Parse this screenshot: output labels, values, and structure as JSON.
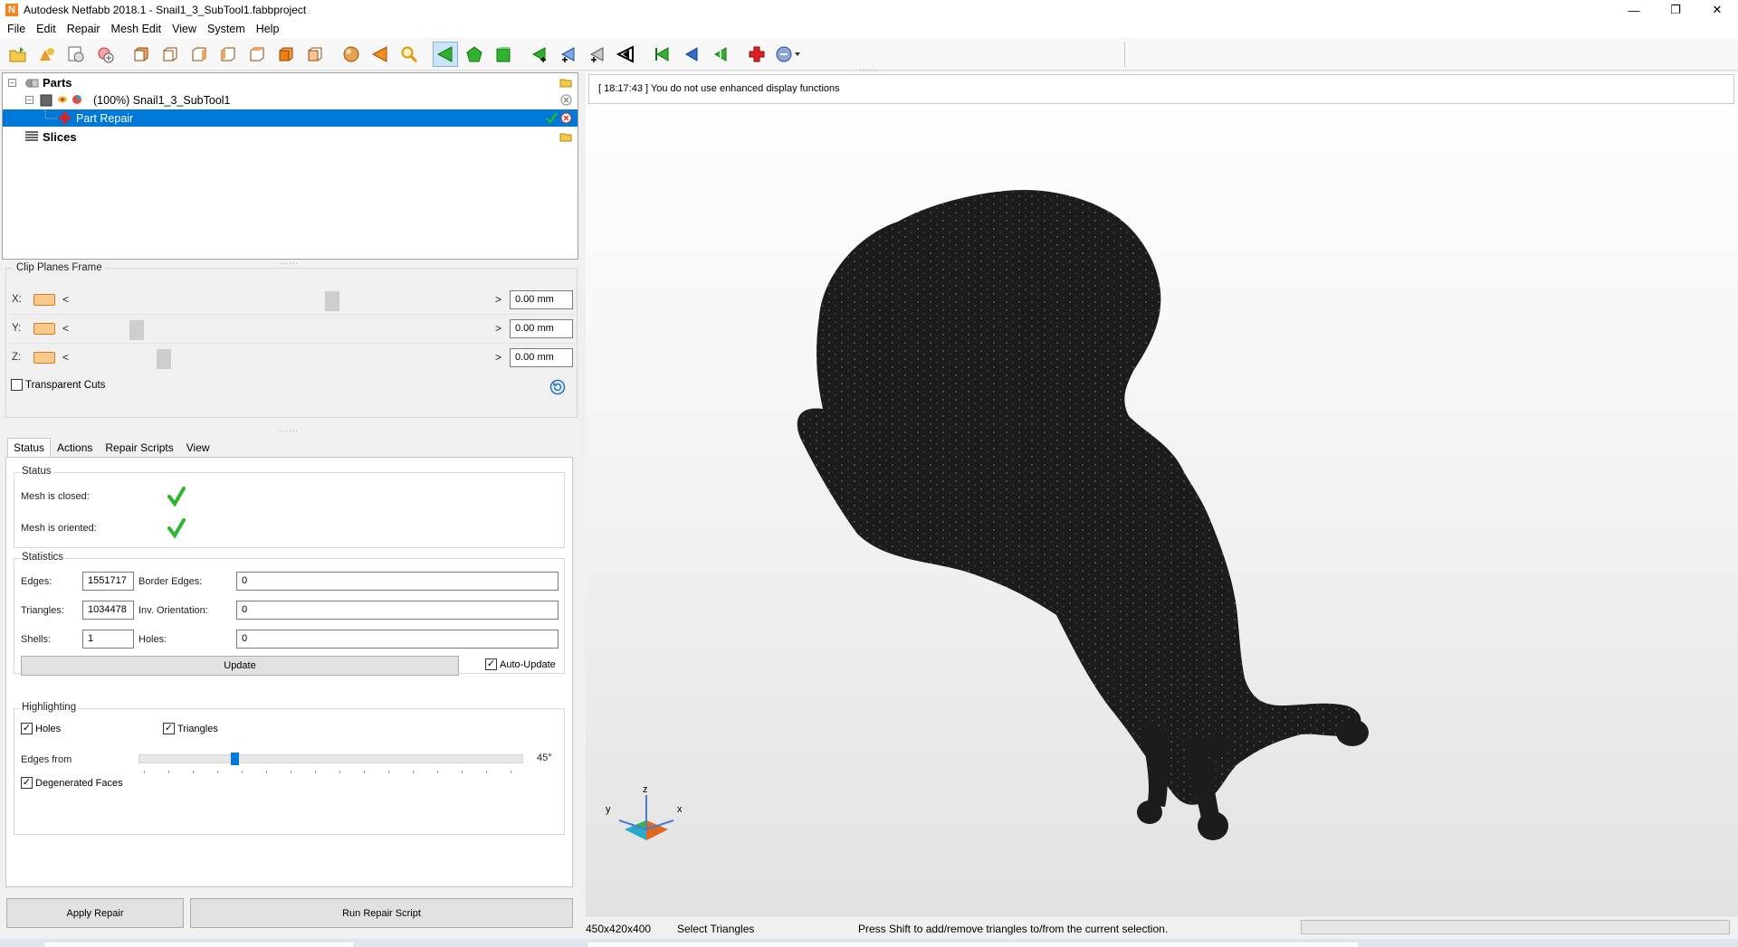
{
  "window": {
    "title": "Autodesk Netfabb 2018.1 - Snail1_3_SubTool1.fabbproject",
    "logo": "N",
    "minimize": "—",
    "restore": "❐",
    "close": "✕"
  },
  "menu": [
    "File",
    "Edit",
    "Repair",
    "Mesh Edit",
    "View",
    "System",
    "Help"
  ],
  "tree": {
    "parts_label": "Parts",
    "part_name": "(100%) Snail1_3_SubTool1",
    "repair_label": "Part Repair",
    "slices_label": "Slices"
  },
  "clip_planes": {
    "title": "Clip Planes Frame",
    "x_label": "X:",
    "y_label": "Y:",
    "z_label": "Z:",
    "x_value": "0.00 mm",
    "y_value": "0.00 mm",
    "z_value": "0.00 mm",
    "transparent_cuts": "Transparent Cuts",
    "left_arrow": "<",
    "right_arrow": ">"
  },
  "tabs": [
    "Status",
    "Actions",
    "Repair Scripts",
    "View"
  ],
  "status_group": {
    "title": "Status",
    "mesh_closed": "Mesh is closed:",
    "mesh_oriented": "Mesh is oriented:"
  },
  "statistics": {
    "title": "Statistics",
    "edges_label": "Edges:",
    "edges_value": "1551717",
    "border_edges_label": "Border Edges:",
    "border_edges_value": "0",
    "triangles_label": "Triangles:",
    "triangles_value": "1034478",
    "inv_orientation_label": "Inv. Orientation:",
    "inv_orientation_value": "0",
    "shells_label": "Shells:",
    "shells_value": "1",
    "holes_label": "Holes:",
    "holes_value": "0",
    "update_button": "Update",
    "auto_update": "Auto-Update"
  },
  "highlighting": {
    "title": "Highlighting",
    "holes": "Holes",
    "triangles": "Triangles",
    "edges_from": "Edges from",
    "edges_angle": "45°",
    "degenerated_faces": "Degenerated Faces"
  },
  "buttons": {
    "apply_repair": "Apply Repair",
    "run_repair_script": "Run Repair Script"
  },
  "log_message": "[ 18:17:43 ] You do not use enhanced display functions",
  "axes": {
    "x": "x",
    "y": "y",
    "z": "z"
  },
  "statusbar": {
    "dimensions": "450x420x400",
    "mode": "Select Triangles",
    "hint": "Press Shift to add/remove triangles to/from the current selection."
  },
  "colors": {
    "selection": "#0078d7",
    "mesh": "#1c1c1c",
    "ok_check": "#2db52d",
    "repair_cross": "#e02020"
  }
}
